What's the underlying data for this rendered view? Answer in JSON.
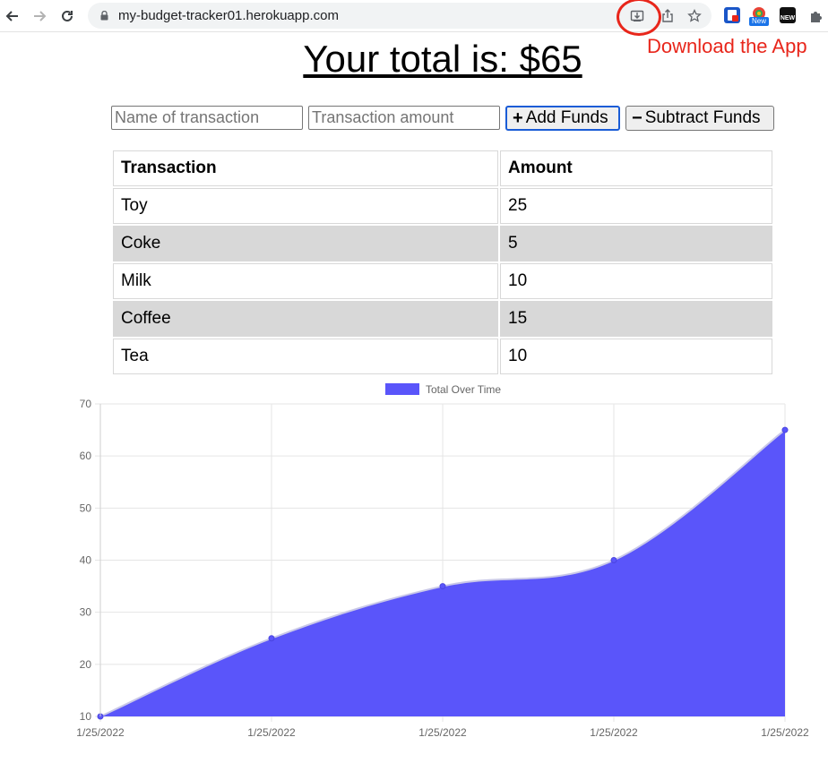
{
  "browser": {
    "url": "my-budget-tracker01.herokuapp.com",
    "icons": [
      "back-icon",
      "forward-icon",
      "reload-icon",
      "lock-icon",
      "install-app-icon",
      "share-icon",
      "bookmark-star-icon",
      "extension-icon",
      "puzzle-icon"
    ],
    "extension_badge_new": "New",
    "extension_badge_new2": "NEW"
  },
  "annotation": {
    "text": "Download the App",
    "color": "#e8261b"
  },
  "header": {
    "total_text": "Your total is: $65"
  },
  "form": {
    "name_placeholder": "Name of transaction",
    "amount_placeholder": "Transaction amount",
    "add_label": "Add Funds",
    "add_icon": "+",
    "subtract_label": "Subtract Funds",
    "subtract_icon": "−"
  },
  "table": {
    "headers": [
      "Transaction",
      "Amount"
    ],
    "rows": [
      {
        "name": "Toy",
        "amount": "25"
      },
      {
        "name": "Coke",
        "amount": "5"
      },
      {
        "name": "Milk",
        "amount": "10"
      },
      {
        "name": "Coffee",
        "amount": "15"
      },
      {
        "name": "Tea",
        "amount": "10"
      }
    ]
  },
  "chart_data": {
    "type": "area",
    "x": [
      "1/25/2022",
      "1/25/2022",
      "1/25/2022",
      "1/25/2022",
      "1/25/2022"
    ],
    "series": [
      {
        "name": "Total Over Time",
        "values": [
          10,
          25,
          35,
          40,
          65
        ],
        "color": "#5a55fa"
      }
    ],
    "ylim": [
      10,
      70
    ],
    "yticks": [
      10,
      20,
      30,
      40,
      50,
      60,
      70
    ],
    "grid": true,
    "legend_position": "top-center",
    "title": "",
    "xlabel": "",
    "ylabel": ""
  }
}
